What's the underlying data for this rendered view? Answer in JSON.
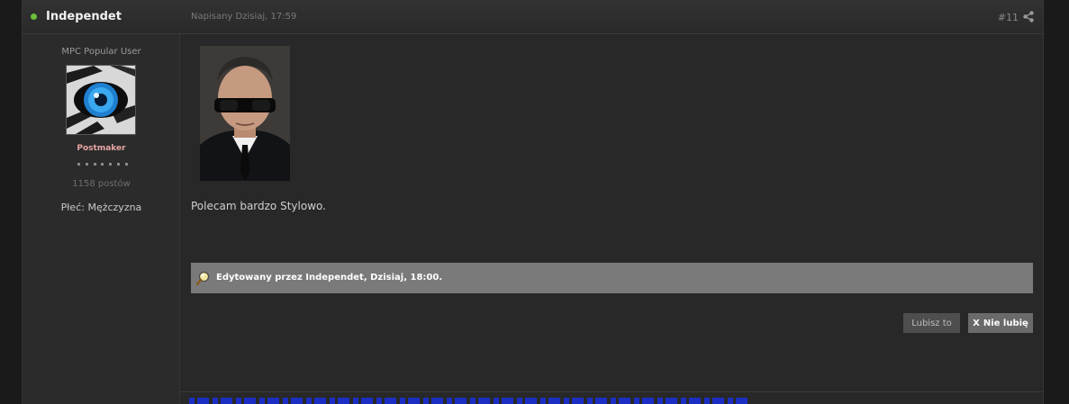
{
  "post": {
    "author": "Independet",
    "date": "Napisany Dzisiaj, 17:59",
    "number": "#11",
    "author_panel": {
      "member_title": "MPC Popular User",
      "rank": "Postmaker",
      "post_count": "1158 postów",
      "gender": "Płeć: Mężczyzna"
    },
    "body_text": "Polecam bardzo Stylowo.",
    "edit_note": "Edytowany przez Independet, Dzisiaj, 18:00.",
    "buttons": {
      "like": "Lubisz to",
      "dislike_mark": "X",
      "dislike": "Nie lubię"
    }
  },
  "colors": {
    "online": "#6cbf3a",
    "rank": "#e8a5a5",
    "edit_bar": "#7a7a7a"
  },
  "icons": [
    "online-status-icon",
    "share-icon",
    "edit-magnifier-icon"
  ]
}
